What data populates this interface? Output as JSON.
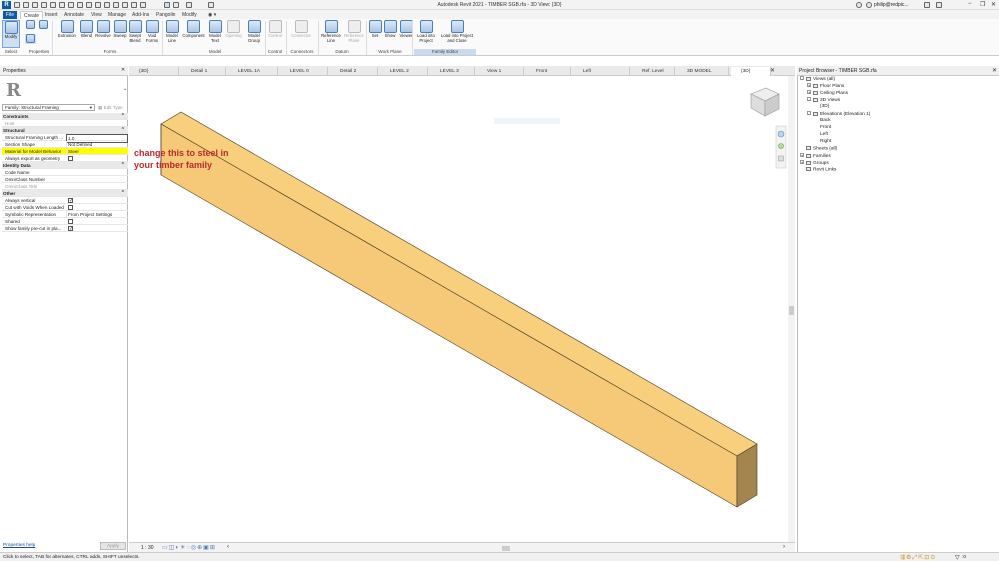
{
  "window": {
    "title": "Autodesk Revit 2021 - TIMBER SGB.rfa - 3D View: {3D}",
    "user": "philip@redpic...",
    "app_logo": "R"
  },
  "ribbon_tabs": [
    "File",
    "Create",
    "Insert",
    "Annotate",
    "View",
    "Manage",
    "Add-Ins",
    "Pangolin",
    "Modify"
  ],
  "ribbon": {
    "buttons": [
      {
        "label": "Modify",
        "icon": "cursor-icon"
      },
      {
        "label": "Extrusion",
        "icon": "extrusion-icon"
      },
      {
        "label": "Blend",
        "icon": "blend-icon"
      },
      {
        "label": "Revolve",
        "icon": "revolve-icon"
      },
      {
        "label": "Sweep",
        "icon": "sweep-icon"
      },
      {
        "label": "Swept Blend",
        "icon": "swept-blend-icon"
      },
      {
        "label": "Void Forms",
        "icon": "void-forms-icon"
      },
      {
        "label": "Model Line",
        "icon": "model-line-icon"
      },
      {
        "label": "Component",
        "icon": "component-icon"
      },
      {
        "label": "Model Text",
        "icon": "model-text-icon"
      },
      {
        "label": "Opening",
        "icon": "opening-icon"
      },
      {
        "label": "Model Group",
        "icon": "model-group-icon"
      },
      {
        "label": "Control",
        "icon": "control-icon"
      },
      {
        "label": "Connector",
        "icon": "connector-icon"
      },
      {
        "label": "Reference Line",
        "icon": "reference-line-icon"
      },
      {
        "label": "Reference Plane",
        "icon": "reference-plane-icon"
      },
      {
        "label": "Set",
        "icon": "set-icon"
      },
      {
        "label": "Show",
        "icon": "show-icon"
      },
      {
        "label": "Viewer",
        "icon": "viewer-icon"
      },
      {
        "label": "Load into Project",
        "icon": "load-project-icon"
      },
      {
        "label": "Load into Project and Close",
        "icon": "load-close-icon"
      }
    ],
    "panels": [
      "Select",
      "Properties",
      "Forms",
      "Model",
      "Control",
      "Connectors",
      "Datum",
      "Work Plane",
      "Family Editor"
    ]
  },
  "properties": {
    "title": "Properties",
    "family_selector": "Family: Structural Framing",
    "edit_type": "Edit Type",
    "rows": [
      {
        "k": "Constraints",
        "v": "",
        "type": "group"
      },
      {
        "k": "Host",
        "v": "",
        "type": "grey"
      },
      {
        "k": "Structural",
        "v": "",
        "type": "group"
      },
      {
        "k": "Structural Framing Length ...",
        "v": "1.0",
        "type": "input"
      },
      {
        "k": "Section Shape",
        "v": "Not Defined",
        "type": "normal"
      },
      {
        "k": "Material for Model Behavior",
        "v": "Steel",
        "type": "hl"
      },
      {
        "k": "Always export as geometry",
        "v": "",
        "type": "check-off"
      },
      {
        "k": "Identity Data",
        "v": "",
        "type": "group"
      },
      {
        "k": "Code Name",
        "v": "",
        "type": "normal"
      },
      {
        "k": "OmniClass Number",
        "v": "",
        "type": "normal"
      },
      {
        "k": "OmniClass Title",
        "v": "",
        "type": "grey"
      },
      {
        "k": "Other",
        "v": "",
        "type": "group"
      },
      {
        "k": "Always vertical",
        "v": "",
        "type": "check-on"
      },
      {
        "k": "Cut with Voids When Loaded",
        "v": "",
        "type": "check-off"
      },
      {
        "k": "Symbolic Representation",
        "v": "From Project Settings",
        "type": "normal"
      },
      {
        "k": "Shared",
        "v": "",
        "type": "check-off"
      },
      {
        "k": "Show family pre-cut in pla...",
        "v": "",
        "type": "check-on"
      }
    ],
    "help_link": "Properties help",
    "apply_button": "Apply"
  },
  "annotation": {
    "line1": "change this to steel in",
    "line2": "your timber family",
    "color": "#c0282b"
  },
  "view_tabs": [
    {
      "label": "{3D}",
      "active": false
    },
    {
      "label": "Detail 1",
      "active": false
    },
    {
      "label": "LEVEL 1A",
      "active": false
    },
    {
      "label": "LEVEL 0",
      "active": false
    },
    {
      "label": "Detail 2",
      "active": false
    },
    {
      "label": "LEVEL 2",
      "active": false
    },
    {
      "label": "LEVEL 3",
      "active": false
    },
    {
      "label": "View 1",
      "active": false
    },
    {
      "label": "Front",
      "active": false
    },
    {
      "label": "Left",
      "active": false
    },
    {
      "label": "Ref. Level",
      "active": false
    },
    {
      "label": "3D MODEL",
      "active": false
    },
    {
      "label": "{3D}",
      "active": true
    }
  ],
  "model": {
    "beam_top_color": "#f7cf7d",
    "beam_side_color": "#f5c978",
    "beam_end_color": "#a5854f",
    "edge_color": "#4a3b22"
  },
  "project_browser": {
    "title": "Project Browser - TIMBER SGB.rfa",
    "items": [
      {
        "label": "Views (all)",
        "level": 0,
        "toggle": "-"
      },
      {
        "label": "Floor Plans",
        "level": 1,
        "toggle": "+"
      },
      {
        "label": "Ceiling Plans",
        "level": 1,
        "toggle": "+"
      },
      {
        "label": "3D Views",
        "level": 1,
        "toggle": "-"
      },
      {
        "label": "{3D}",
        "level": 2,
        "toggle": ""
      },
      {
        "label": "Elevations (Elevation 1)",
        "level": 1,
        "toggle": "-"
      },
      {
        "label": "Back",
        "level": 2,
        "toggle": ""
      },
      {
        "label": "Front",
        "level": 2,
        "toggle": ""
      },
      {
        "label": "Left",
        "level": 2,
        "toggle": ""
      },
      {
        "label": "Right",
        "level": 2,
        "toggle": ""
      },
      {
        "label": "Sheets (all)",
        "level": 0,
        "toggle": ""
      },
      {
        "label": "Families",
        "level": 0,
        "toggle": "+"
      },
      {
        "label": "Groups",
        "level": 0,
        "toggle": "+"
      },
      {
        "label": "Revit Links",
        "level": 0,
        "toggle": ""
      }
    ]
  },
  "view_bar": {
    "scale": "1 : 30"
  },
  "status_bar": {
    "text": "Click to select, TAB for alternates, CTRL adds, SHIFT unselects.",
    "selection_count": ":0"
  }
}
